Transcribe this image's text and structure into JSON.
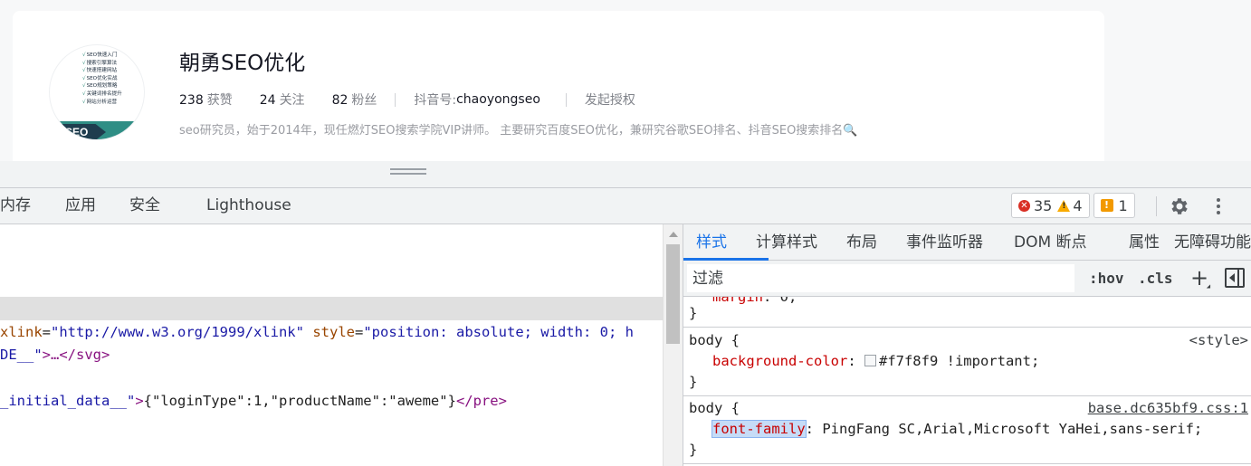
{
  "profile": {
    "name": "朝勇SEO优化",
    "avatar": {
      "lines": [
        "SEO快速入门",
        "搜索引擎算法",
        "快速搭建网站",
        "SEO优化实战",
        "SEO规划策略",
        "关键词排名提升",
        "网站分析运营"
      ],
      "tag": "SEO"
    },
    "stats": [
      {
        "num": "238",
        "label": "获赞"
      },
      {
        "num": "24",
        "label": "关注"
      },
      {
        "num": "82",
        "label": "粉丝"
      }
    ],
    "douyin_label": "抖音号:",
    "douyin_id": "chaoyongseo",
    "grant_label": "发起授权",
    "bio": "seo研究员，始于2014年，现任燃灯SEO搜索学院VIP讲师。 主要研究百度SEO优化，兼研究谷歌SEO排名、抖音SEO搜索排名",
    "bio_emoji": "🔍"
  },
  "devtools": {
    "tabs": [
      "内存",
      "应用",
      "安全",
      "Lighthouse"
    ],
    "errors": "35",
    "warnings": "4",
    "issues": "1",
    "elements": {
      "line1": {
        "attr1": "xlink",
        "val1": "\"http://www.w3.org/1999/xlink\"",
        "attr2": "style",
        "val2": "\"position: absolute; width: 0; h"
      },
      "line2": {
        "val": "DE__\"",
        "tag": ">…</svg>"
      },
      "line3": {
        "val": "_initial_data__\"",
        "open": ">",
        "text": "{\"loginType\":1,\"productName\":\"aweme\"}",
        "close": "</pre>"
      }
    },
    "styles": {
      "tabs": [
        "样式",
        "计算样式",
        "布局",
        "事件监听器",
        "DOM 断点",
        "属性",
        "无障碍功能"
      ],
      "filter_placeholder": "过滤",
      "hov": ":hov",
      "cls": ".cls",
      "rules": [
        {
          "partial_prop": "margin",
          "partial_val": "0",
          "close": "}"
        },
        {
          "selector": "body {",
          "source": "<style>",
          "prop": "background-color",
          "value": "#f7f8f9 !important;",
          "close": "}"
        },
        {
          "selector": "body {",
          "source": "base.dc635bf9.css:1",
          "prop": "font-family",
          "value": "PingFang SC,Arial,Microsoft YaHei,sans-serif;",
          "close": "}"
        }
      ]
    }
  },
  "colors": {
    "accent": "#1a73e8",
    "error": "#d93025",
    "warning": "#f9ab00",
    "page_bg": "#f7f8f9"
  }
}
